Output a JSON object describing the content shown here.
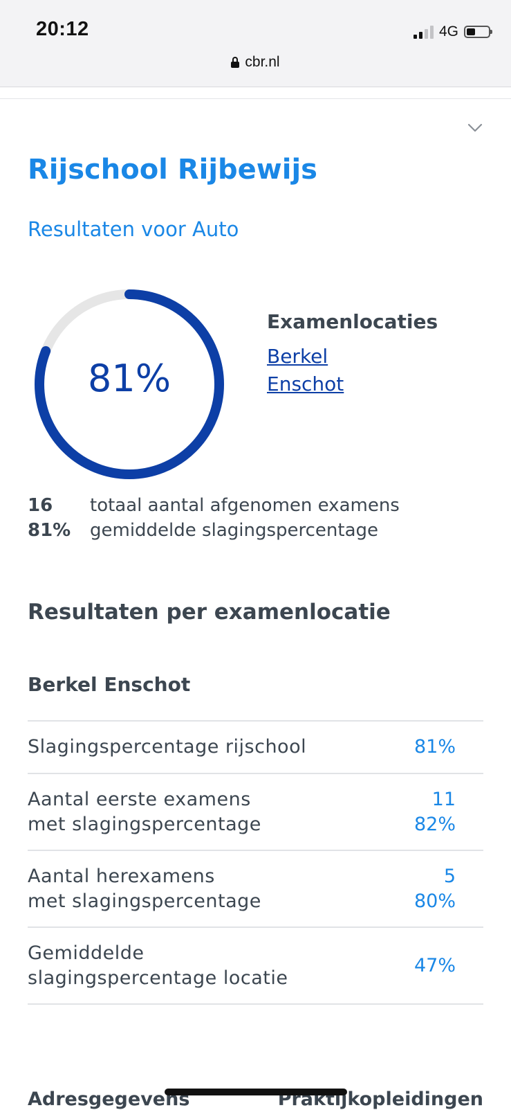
{
  "status_bar": {
    "time": "20:12",
    "network": "4G"
  },
  "browser": {
    "url": "cbr.nl"
  },
  "header": {
    "title": "Rijschool Rijbewijs",
    "subtitle": "Resultaten voor Auto"
  },
  "overview": {
    "pass_rate_label": "81%",
    "pass_rate_fraction": 0.81,
    "locations_heading": "Examenlocaties",
    "locations": [
      "Berkel",
      "Enschot"
    ],
    "stats": [
      {
        "value": "16",
        "label": "totaal aantal afgenomen examens"
      },
      {
        "value": "81%",
        "label": "gemiddelde slagingspercentage"
      }
    ]
  },
  "results": {
    "heading": "Resultaten per examenlocatie",
    "location_name": "Berkel Enschot",
    "rows": [
      {
        "label": [
          "Slagingspercentage rijschool"
        ],
        "values": [
          "81%"
        ]
      },
      {
        "label": [
          "Aantal eerste examens",
          "met slagingspercentage"
        ],
        "values": [
          "11",
          "82%"
        ]
      },
      {
        "label": [
          "Aantal herexamens",
          "met slagingspercentage"
        ],
        "values": [
          "5",
          "80%"
        ]
      },
      {
        "label": [
          "Gemiddelde",
          "slagingspercentage locatie"
        ],
        "values": [
          "47%"
        ]
      }
    ]
  },
  "footer": {
    "tab_left": "Adresgegevens",
    "tab_right": "Praktijkopleidingen"
  },
  "colors": {
    "accent_blue": "#1a87e6",
    "ring_blue": "#0d3fa6",
    "ring_track": "#e6e6e6",
    "text": "#3c4650"
  },
  "icons": {
    "lock": "lock-icon",
    "chevron": "chevron-down-icon",
    "signal": "signal-icon",
    "battery": "battery-icon"
  }
}
